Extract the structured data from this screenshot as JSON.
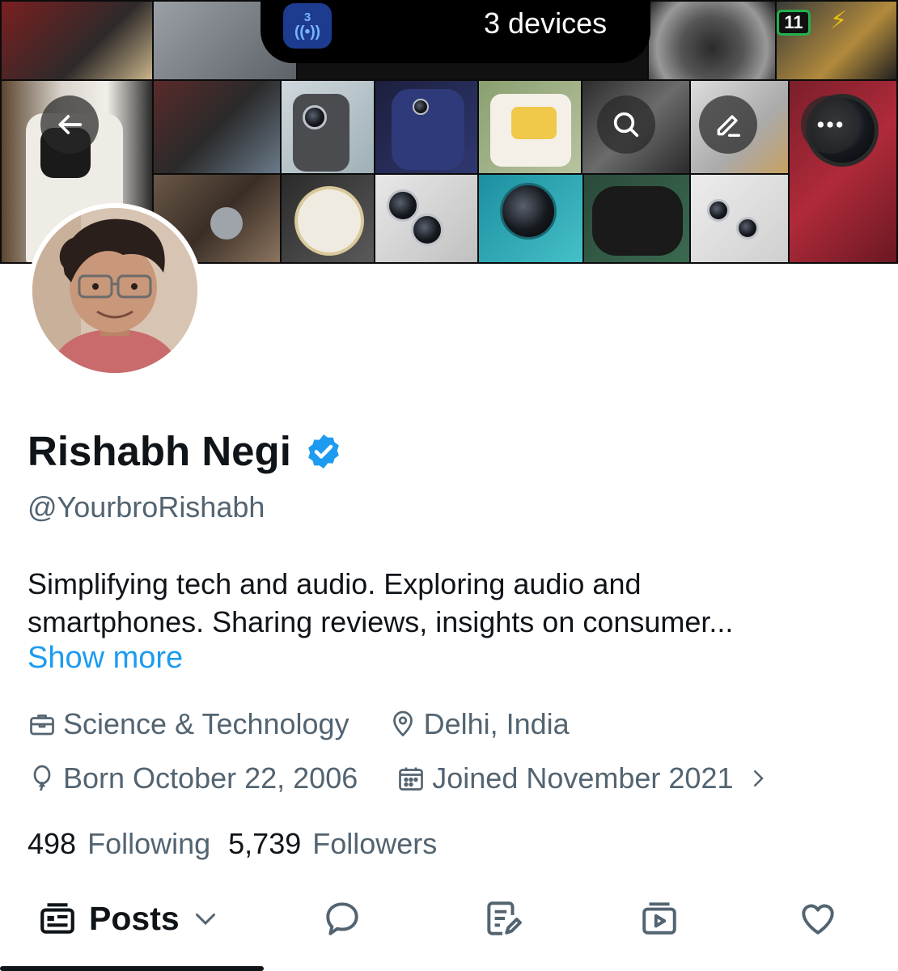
{
  "status_bar": {
    "island_badge_number": "3",
    "island_badge_icon": "broadcast-icon",
    "island_text": "3 devices",
    "battery": "11",
    "charging_icon": "lightning-icon"
  },
  "header": {
    "back_icon": "arrow-left-icon",
    "search_icon": "search-icon",
    "edit_icon": "edit-icon",
    "more_icon": "more-icon"
  },
  "profile": {
    "name": "Rishabh Negi",
    "verified_icon": "verified-badge-icon",
    "handle": "@YourbroRishabh",
    "bio_line1": "Simplifying tech and audio. Exploring audio and",
    "bio_line2": "smartphones. Sharing reviews, insights on consumer...",
    "show_more": "Show more",
    "category": "Science & Technology",
    "location": "Delhi, India",
    "birthday": "Born October 22, 2006",
    "joined": "Joined November 2021",
    "following_count": "498",
    "following_label": "Following",
    "followers_count": "5,739",
    "followers_label": "Followers"
  },
  "tabs": {
    "posts_label": "Posts",
    "posts_icon": "posts-icon",
    "replies_icon": "reply-bubble-icon",
    "articles_icon": "article-edit-icon",
    "media_icon": "media-play-icon",
    "likes_icon": "heart-icon"
  },
  "colors": {
    "accent": "#1d9bf0",
    "text_primary": "#0f1419",
    "text_secondary": "#536471"
  }
}
